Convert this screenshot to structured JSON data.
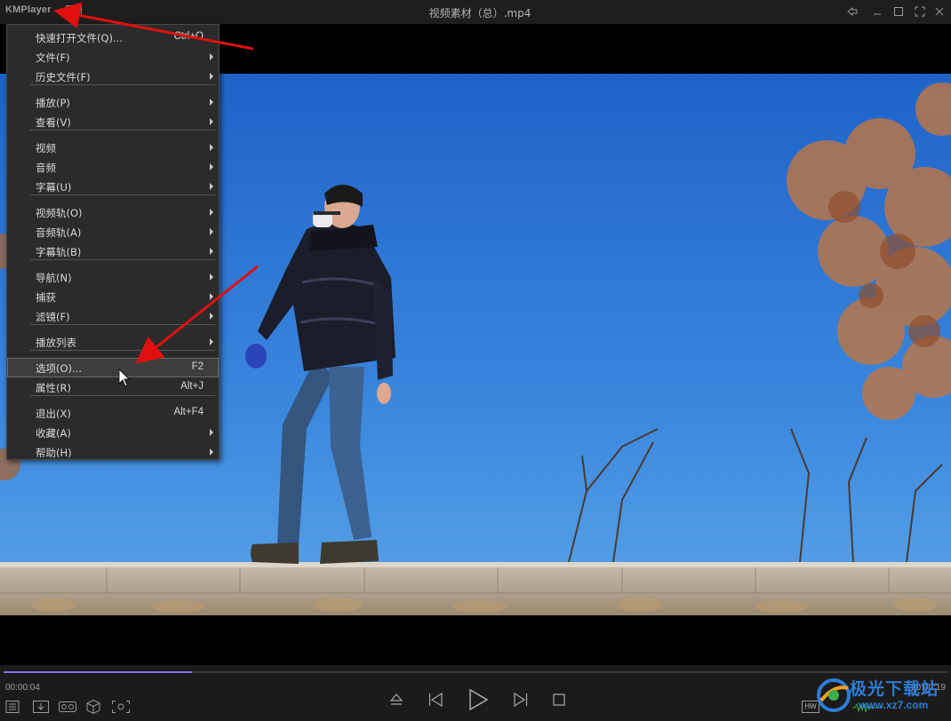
{
  "app": {
    "logo": "KMPlayer",
    "window_title": "视频素材（总）.mp4"
  },
  "icons": {
    "menu": "menu-icon",
    "pin": "pin-icon",
    "minimize": "minimize-icon",
    "maximize": "maximize-icon",
    "fullscreen": "fullscreen-icon",
    "close": "close-icon"
  },
  "menu": {
    "items": [
      {
        "label": "快速打开文件(Q)...",
        "shortcut": "Ctrl+O",
        "submenu": false
      },
      {
        "label": "文件(F)",
        "shortcut": "",
        "submenu": true
      },
      {
        "label": "历史文件(F)",
        "shortcut": "",
        "submenu": true
      },
      {
        "label": "播放(P)",
        "shortcut": "",
        "submenu": true
      },
      {
        "label": "查看(V)",
        "shortcut": "",
        "submenu": true
      },
      {
        "label": "视频",
        "shortcut": "",
        "submenu": true
      },
      {
        "label": "音频",
        "shortcut": "",
        "submenu": true
      },
      {
        "label": "字幕(U)",
        "shortcut": "",
        "submenu": true
      },
      {
        "label": "视频轨(O)",
        "shortcut": "",
        "submenu": true
      },
      {
        "label": "音频轨(A)",
        "shortcut": "",
        "submenu": true
      },
      {
        "label": "字幕轨(B)",
        "shortcut": "",
        "submenu": true
      },
      {
        "label": "导航(N)",
        "shortcut": "",
        "submenu": true
      },
      {
        "label": "捕获",
        "shortcut": "",
        "submenu": true
      },
      {
        "label": "滤镜(F)",
        "shortcut": "",
        "submenu": true
      },
      {
        "label": "播放列表",
        "shortcut": "",
        "submenu": true
      },
      {
        "label": "选项(O)...",
        "shortcut": "F2",
        "submenu": false,
        "highlighted": true
      },
      {
        "label": "属性(R)",
        "shortcut": "Alt+J",
        "submenu": false
      },
      {
        "label": "退出(X)",
        "shortcut": "Alt+F4",
        "submenu": false
      },
      {
        "label": "收藏(A)",
        "shortcut": "",
        "submenu": true
      },
      {
        "label": "帮助(H)",
        "shortcut": "",
        "submenu": true
      }
    ]
  },
  "playback": {
    "current_time": "00:00:04",
    "total_time": "00:00:19",
    "progress": 0.2
  },
  "controls": {
    "left_icons": [
      "playlist-icon",
      "download-icon",
      "vr-glasses-icon",
      "3d-cube-icon",
      "capture-icon"
    ],
    "center_icons": [
      "eject-icon",
      "previous-icon",
      "play-icon",
      "next-icon",
      "stop-icon"
    ],
    "hw_label": "HW"
  },
  "watermark": {
    "text": "极光下载站",
    "url": "www.xz7.com"
  },
  "colors": {
    "accent": "#8a6fe8",
    "sky": "#2f6fd0",
    "annotation_arrow": "#e01010"
  }
}
